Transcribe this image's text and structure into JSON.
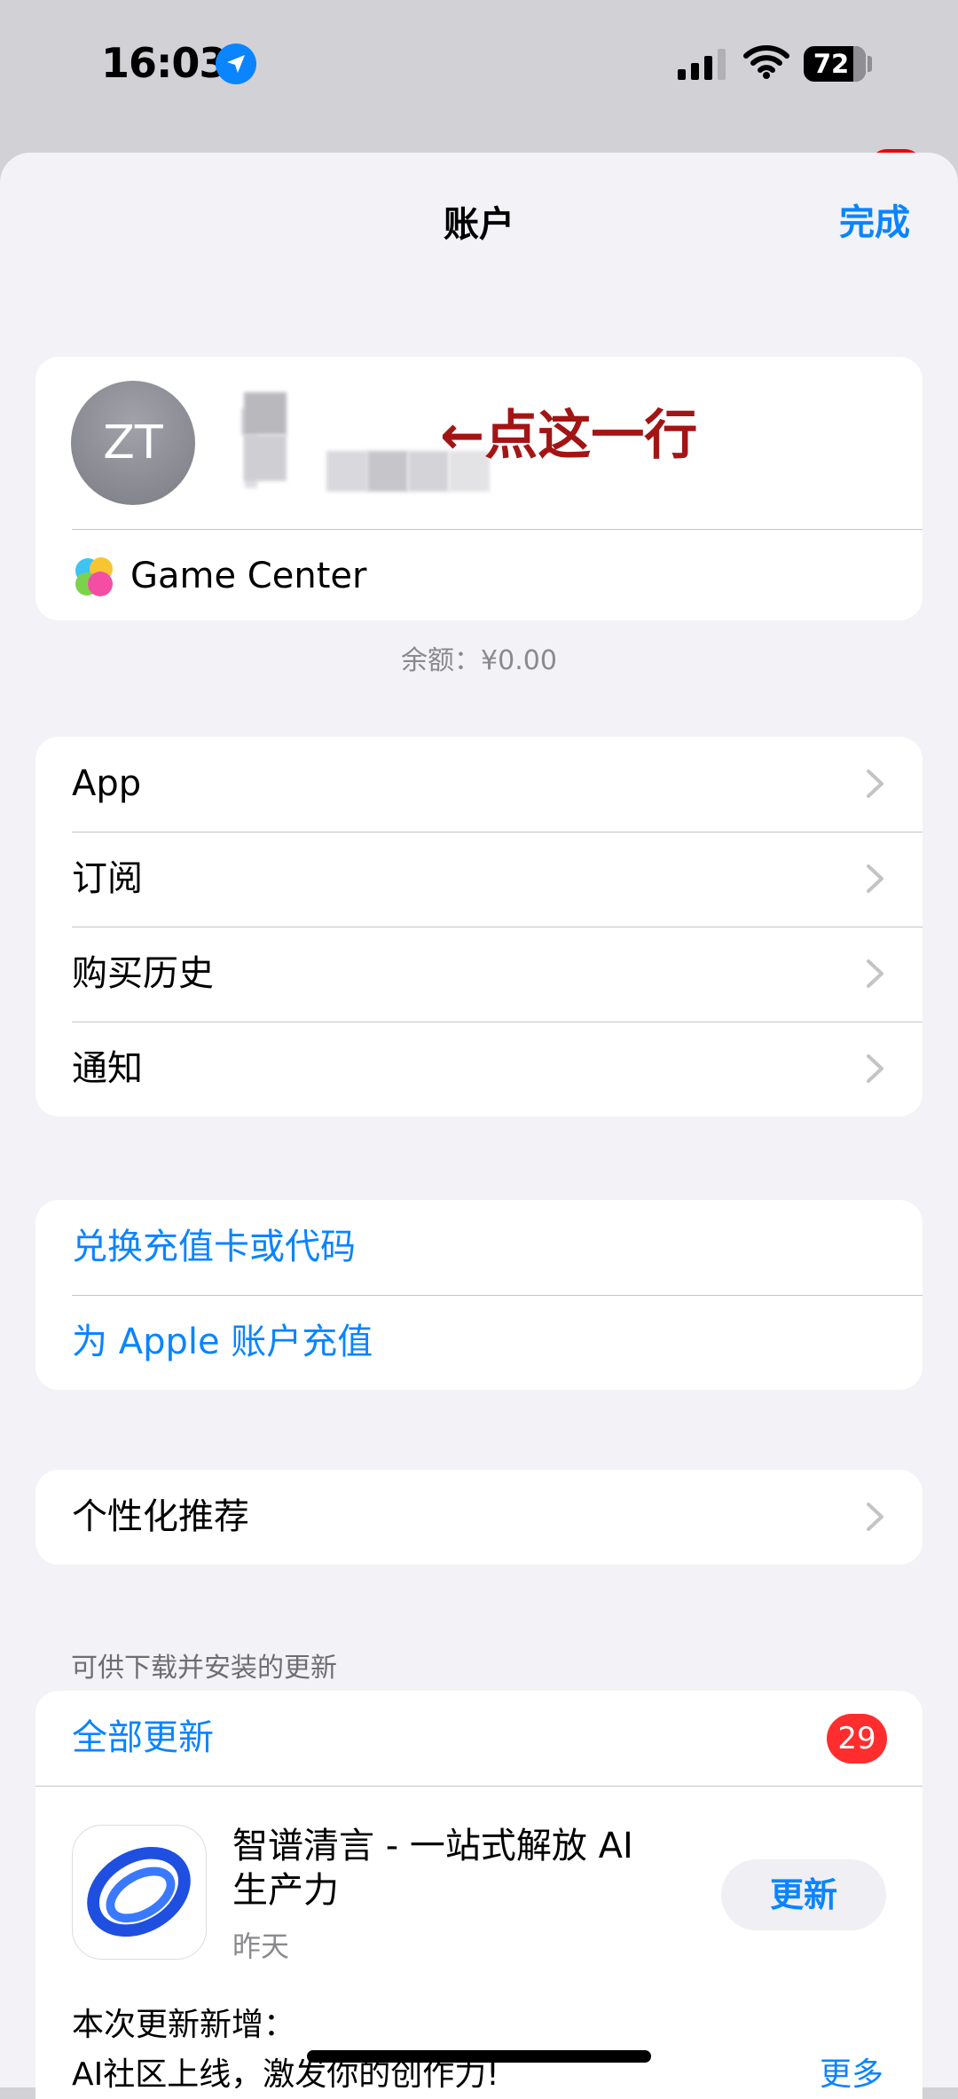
{
  "status": {
    "time": "16:03",
    "battery": "72"
  },
  "sheet": {
    "title": "账户",
    "done_label": "完成"
  },
  "profile": {
    "initials": "ZT",
    "annotation": "←点这一行",
    "game_center_label": "Game Center"
  },
  "balance": "余额：¥0.00",
  "menu": {
    "app": "App",
    "subscriptions": "订阅",
    "purchase_history": "购买历史",
    "notifications": "通知"
  },
  "topup": {
    "redeem": "兑换充值卡或代码",
    "add_funds": "为 Apple 账户充值"
  },
  "personalization": "个性化推荐",
  "updates": {
    "header": "可供下载并安装的更新",
    "update_all": "全部更新",
    "count": "29",
    "app": {
      "name": "智谱清言 - 一站式解放 AI 生产力",
      "date": "昨天",
      "button": "更新",
      "notes_title": "本次更新新增：",
      "notes_text": "AI社区上线，激发你的创作力!",
      "more": "更多"
    }
  },
  "colors": {
    "accent": "#0a84ff",
    "annotation": "#a31515",
    "badge": "#ff2d2d"
  }
}
